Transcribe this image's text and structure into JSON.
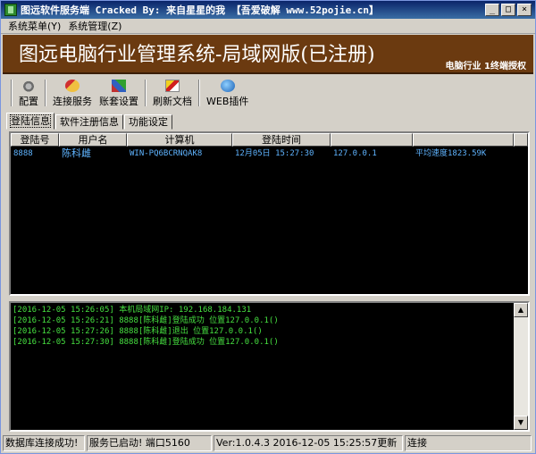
{
  "window": {
    "title": "图远软件服务端 Cracked By: 来自星星的我 【吾爱破解 www.52pojie.cn】",
    "controls": [
      "_",
      "□",
      "×"
    ]
  },
  "menu": [
    "系统菜单(Y)",
    "系统管理(Z)"
  ],
  "banner": {
    "title": "图远电脑行业管理系统-局域网版(已注册)",
    "subtitle": "电脑行业 1终端授权"
  },
  "toolbar": {
    "config": "配置",
    "connect": "连接服务",
    "account": "账套设置",
    "refresh": "刷新文档",
    "web": "WEB插件"
  },
  "tabs": [
    "登陆信息",
    "软件注册信息",
    "功能设定"
  ],
  "online_table": {
    "columns": [
      "登陆号",
      "用户名",
      "计算机",
      "登陆时间",
      "",
      "",
      ""
    ],
    "rows": [
      [
        "8888",
        "陈科雌",
        "WIN-PQ6BCRNQAK8",
        "12月05日 15:27:30",
        "127.0.0.1",
        "平均速度1823.59K",
        ""
      ]
    ]
  },
  "log": [
    "[2016-12-05 15:26:05] 本机局域网IP: 192.168.184.131",
    "[2016-12-05 15:26:21] 8888[陈科雌]登陆成功 位置127.0.0.1()",
    "[2016-12-05 15:27:26] 8888[陈科雌]退出 位置127.0.0.1()",
    "[2016-12-05 15:27:30] 8888[陈科雌]登陆成功 位置127.0.0.1()"
  ],
  "status": {
    "db": "数据库连接成功!",
    "service": "服务已启动! 端口5160",
    "version": "Ver:1.0.4.3 2016-12-05 15:25:57更新",
    "conn": "连接"
  },
  "scroll": {
    "up": "▲",
    "down": "▼"
  },
  "colors": {
    "banner": "#6b3a10",
    "list_text": "#5fb4ff",
    "log_text": "#46e040"
  }
}
